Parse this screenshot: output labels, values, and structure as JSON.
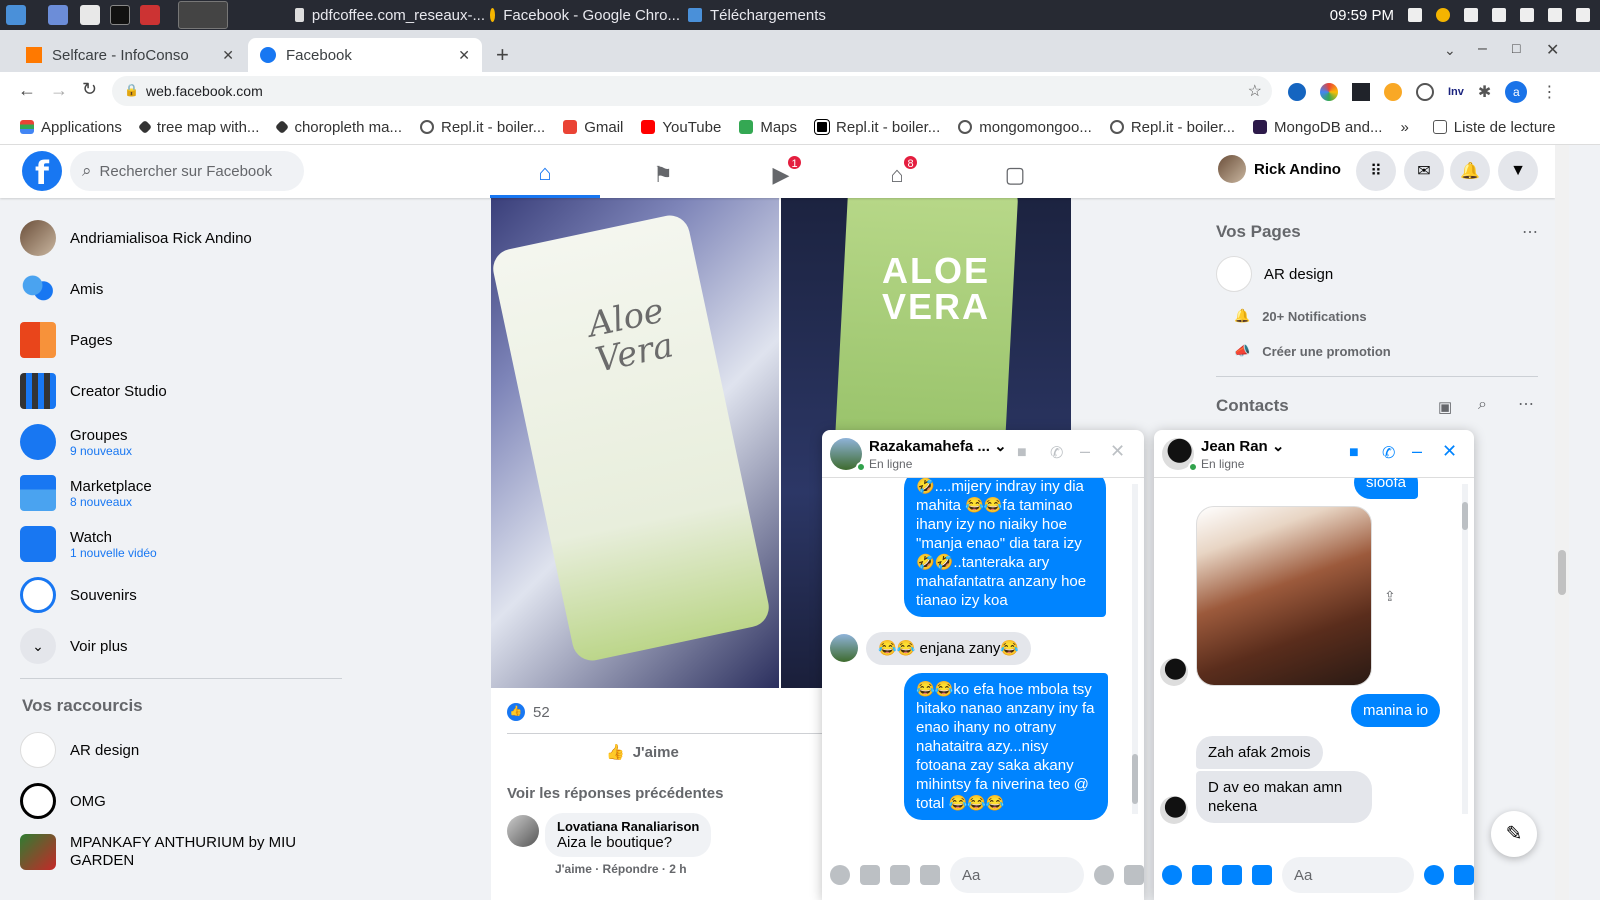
{
  "taskbar": {
    "windows": [
      "pdfcoffee.com_reseaux-...",
      "Facebook - Google Chro...",
      "Téléchargements"
    ],
    "time": "09:59 PM"
  },
  "browser": {
    "tabs": [
      {
        "label": "Selfcare - InfoConso"
      },
      {
        "label": "Facebook"
      }
    ],
    "new_tab": "+",
    "url": "web.facebook.com",
    "profile_initial": "a",
    "ext_inv": "Inv",
    "bookmarks": [
      "Applications",
      "tree map with...",
      "choropleth ma...",
      "Repl.it - boiler...",
      "Gmail",
      "YouTube",
      "Maps",
      "Repl.it - boiler...",
      "mongomongoo...",
      "Repl.it - boiler...",
      "MongoDB and..."
    ],
    "bookmarks_more": "»",
    "reading_list": "Liste de lecture"
  },
  "facebook": {
    "search_placeholder": "Rechercher sur Facebook",
    "nav_badges": {
      "watch": "1",
      "marketplace": "8"
    },
    "user_name": "Rick Andino",
    "left_menu": [
      {
        "label": "Andriamialisoa Rick Andino",
        "sub": ""
      },
      {
        "label": "Amis",
        "sub": ""
      },
      {
        "label": "Pages",
        "sub": ""
      },
      {
        "label": "Creator Studio",
        "sub": ""
      },
      {
        "label": "Groupes",
        "sub": "9 nouveaux"
      },
      {
        "label": "Marketplace",
        "sub": "8 nouveaux"
      },
      {
        "label": "Watch",
        "sub": "1 nouvelle vidéo"
      },
      {
        "label": "Souvenirs",
        "sub": ""
      },
      {
        "label": "Voir plus",
        "sub": ""
      }
    ],
    "shortcuts_title": "Vos raccourcis",
    "shortcuts": [
      "AR design",
      "OMG",
      "MPANKAFY ANTHURIUM by MIU GARDEN"
    ],
    "post": {
      "image_left_text": "Aloe Vera",
      "image_right_text": "ALOE VERA",
      "reactions": "52",
      "like_label": "J'aime",
      "prev_replies": "Voir les réponses précédentes",
      "comment_author": "Lovatiana Ranaliarison",
      "comment_text": "Aiza le boutique?",
      "comment_actions": "J'aime · Répondre · 2 h"
    },
    "right": {
      "pages_title": "Vos Pages",
      "page_name": "AR design",
      "notifications": "20+ Notifications",
      "promotion": "Créer une promotion",
      "contacts_title": "Contacts"
    },
    "chat1": {
      "name": "Razakamahefa ...",
      "status": "En ligne",
      "messages": [
        "🤣....mijery indray iny dia mahita 😂😂fa taminao ihany izy no niaiky hoe \"manja enao\" dia tara izy 🤣🤣..tanteraka ary mahafantatra anzany hoe tianao izy koa",
        "😂😂 enjana zany😂",
        "😂😂ko efa hoe mbola tsy hitako nanao anzany iny fa enao ihany no otrany nahataitra azy...nisy fotoana zay saka akany mihintsy fa niverina teo @ total 😂😂😂"
      ],
      "input_placeholder": "Aa"
    },
    "chat2": {
      "name": "Jean Ran",
      "status": "En ligne",
      "messages": [
        "sioofa",
        "manina io",
        "Zah afak 2mois",
        "D av eo makan amn nekena"
      ],
      "input_placeholder": "Aa"
    }
  }
}
